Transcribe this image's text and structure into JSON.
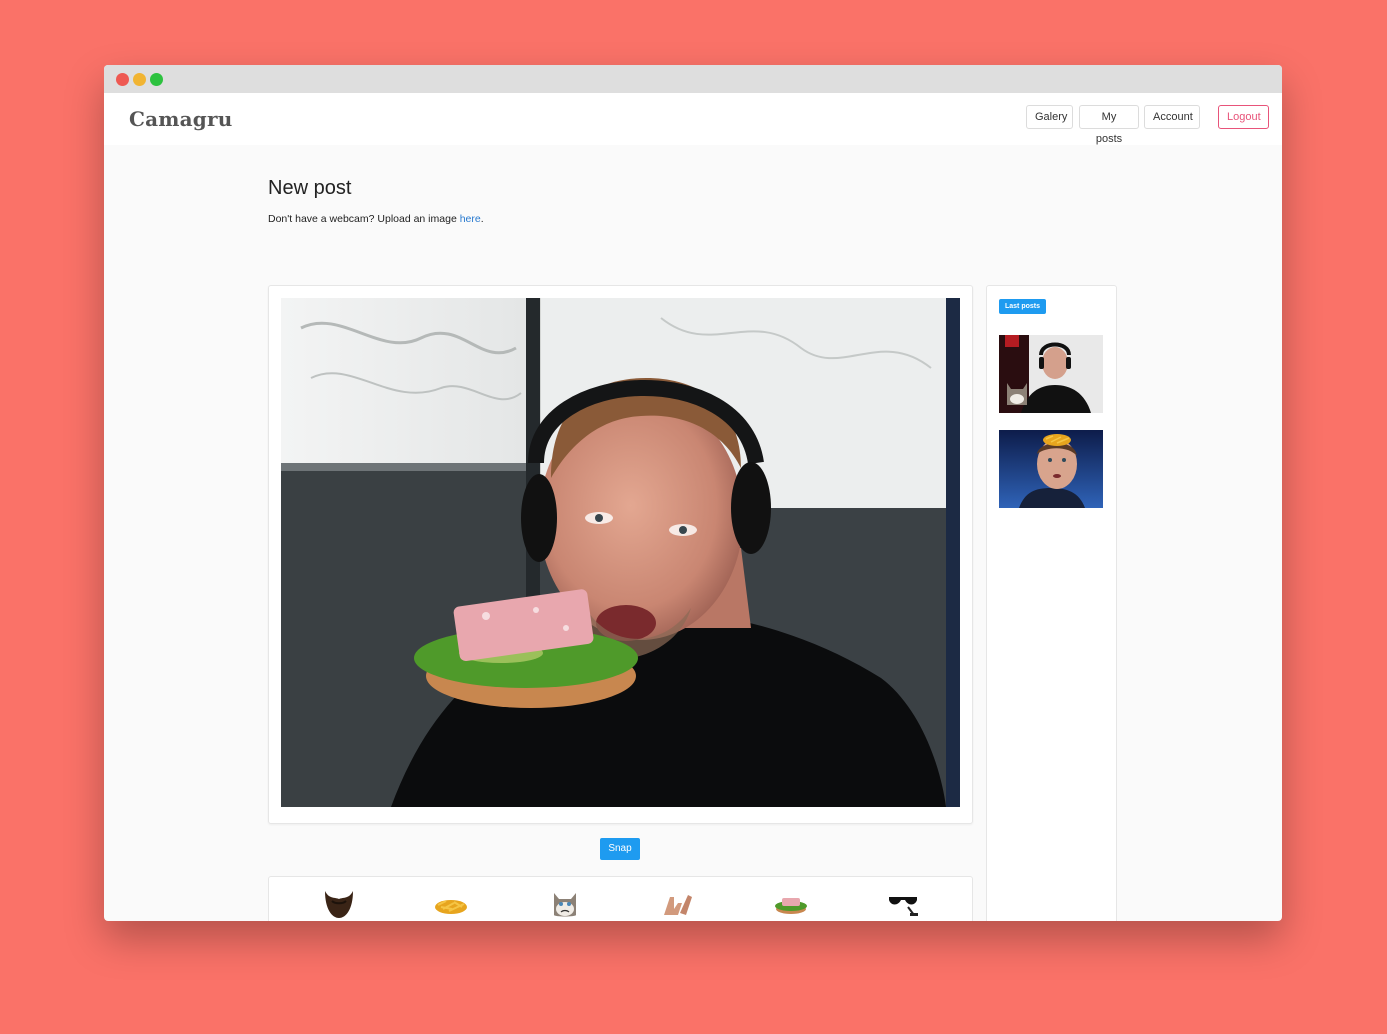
{
  "app": {
    "brand": "Camagru"
  },
  "nav": {
    "items": [
      {
        "label": "Galery"
      },
      {
        "label": "My posts"
      },
      {
        "label": "Account"
      }
    ],
    "logout": "Logout"
  },
  "page": {
    "title": "New post",
    "hint_prefix": "Don't have a webcam? Upload an image ",
    "hint_link": "here",
    "hint_suffix": "."
  },
  "camera": {
    "snap_label": "Snap",
    "overlay_sticker": "sandwich"
  },
  "stickers": [
    {
      "name": "beard"
    },
    {
      "name": "fries"
    },
    {
      "name": "grumpy-cat"
    },
    {
      "name": "hands"
    },
    {
      "name": "sandwich"
    },
    {
      "name": "sunglasses"
    }
  ],
  "sidebar": {
    "badge": "Last posts",
    "posts": [
      {
        "sticker": "grumpy-cat"
      },
      {
        "sticker": "fries"
      }
    ]
  },
  "colors": {
    "background": "#fa7268",
    "accent": "#1e9bf0",
    "logout": "#e8547a",
    "link": "#2779cf"
  }
}
